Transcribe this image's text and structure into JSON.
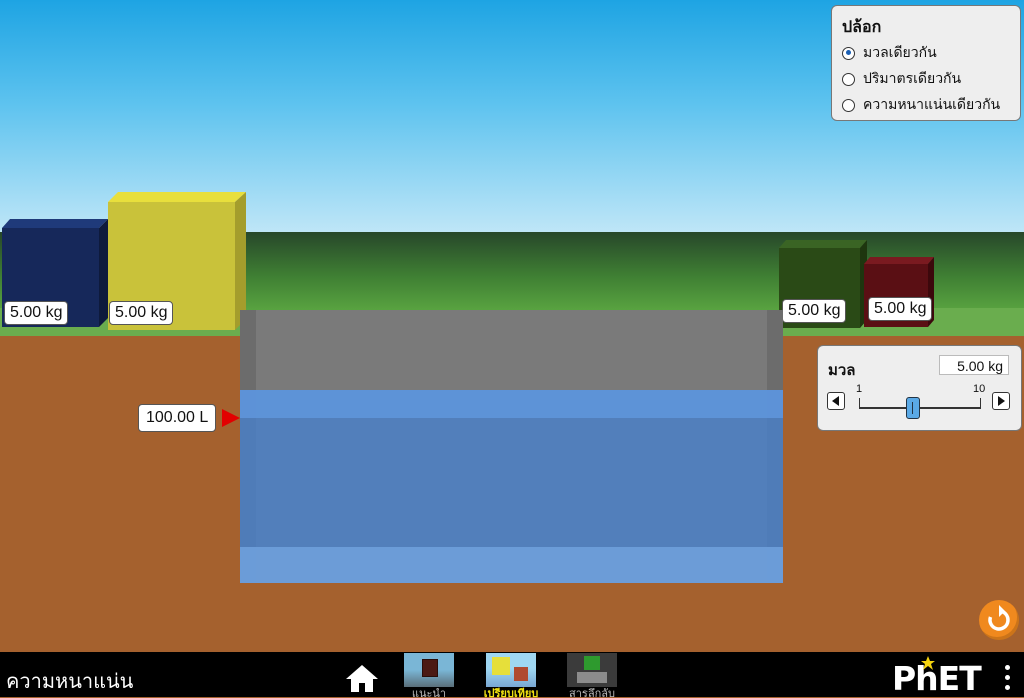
{
  "blocks_panel": {
    "title": "ปล้อก",
    "options": [
      {
        "label": "มวลเดียวกัน",
        "selected": true
      },
      {
        "label": "ปริมาตรเดียวกัน",
        "selected": false
      },
      {
        "label": "ความหนาแน่นเดียวกัน",
        "selected": false
      }
    ]
  },
  "blocks": [
    {
      "name": "navy-block",
      "mass_label": "5.00 kg",
      "color": "#16285a"
    },
    {
      "name": "yellow-block",
      "mass_label": "5.00 kg",
      "color": "#c9c23a"
    },
    {
      "name": "green-block",
      "mass_label": "5.00 kg",
      "color": "#2a4a16"
    },
    {
      "name": "red-block",
      "mass_label": "5.00 kg",
      "color": "#5a0f14"
    }
  ],
  "pool": {
    "volume_label": "100.00 L"
  },
  "mass_control": {
    "title": "มวล",
    "value": "5.00 kg",
    "min_label": "1",
    "max_label": "10",
    "level": 5
  },
  "navbar": {
    "sim_title": "ความหนาแน่น",
    "tabs": [
      {
        "label": "แนะนำ",
        "active": false
      },
      {
        "label": "เปรียบเทียบ",
        "active": true
      },
      {
        "label": "สารลึกลับ",
        "active": false
      }
    ],
    "logo": "PhET"
  },
  "colors": {
    "sky_top": "#1ea4e3",
    "water": "#4682d2",
    "ground": "#a5612e",
    "reset": "#f0891e",
    "active_tab": "#f0e010"
  }
}
